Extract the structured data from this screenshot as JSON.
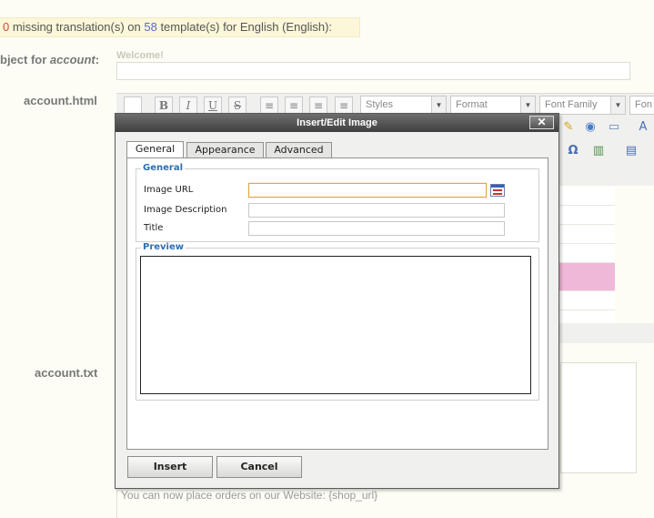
{
  "notice": {
    "count_missing": "0",
    "text_a": " missing translation(s) on ",
    "count_templates": "58",
    "text_b": " template(s) for English (English):"
  },
  "labels": {
    "subject_prefix": "bject for ",
    "subject_italic": "account",
    "subject_suffix": ":",
    "account_html": "account.html",
    "account_txt": "account.txt"
  },
  "subject": {
    "caption": "Welcome!"
  },
  "toolbar": {
    "bold": "B",
    "italic": "I",
    "underline": "U",
    "strike": "S",
    "styles": "Styles",
    "format": "Format",
    "font_family": "Font Family",
    "font_size": "Fon",
    "omega": "Ω"
  },
  "dialog": {
    "title": "Insert/Edit Image",
    "close": "✕",
    "tabs": [
      "General",
      "Appearance",
      "Advanced"
    ],
    "general_legend": "General",
    "fields": {
      "image_url": "Image URL",
      "image_description": "Image Description",
      "title": "Title"
    },
    "preview_legend": "Preview",
    "insert": "Insert",
    "cancel": "Cancel"
  },
  "body_text": "You can now place orders on our Website: {shop_url}"
}
